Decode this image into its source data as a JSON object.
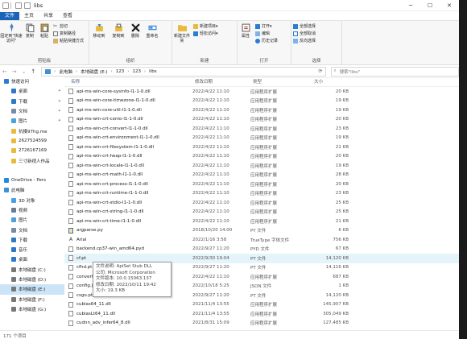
{
  "window": {
    "title": "libs"
  },
  "tabs": [
    "文件",
    "主页",
    "共享",
    "查看"
  ],
  "ribbon": {
    "clipboard": {
      "label": "剪贴板",
      "pin": "固定到\"快速访问\"",
      "copy": "复制",
      "paste": "粘贴",
      "cut": "剪切",
      "copy_path": "复制路径",
      "paste_shortcut": "粘贴快捷方式"
    },
    "organize": {
      "label": "组织",
      "move_to": "移动到",
      "copy_to": "复制到",
      "delete": "删除",
      "rename": "重命名"
    },
    "new": {
      "label": "新建",
      "new_folder": "新建文件夹",
      "new_item": "新建项目",
      "easy_access": "轻松访问"
    },
    "open": {
      "label": "打开",
      "properties": "属性",
      "open": "打开",
      "edit": "编辑",
      "history": "历史记录"
    },
    "select": {
      "label": "选择",
      "select_all": "全部选择",
      "select_none": "全部取消",
      "invert": "反向选择"
    }
  },
  "address": {
    "crumbs": [
      "此电脑",
      "本地磁盘 (E:)",
      "123",
      "123",
      "libs"
    ],
    "search_placeholder": "搜索\"libs\""
  },
  "sidebar": {
    "items": [
      {
        "label": "快速访问",
        "icon": "star-icon",
        "color": "#2b7cd3",
        "indent": 0
      },
      {
        "label": "桌面",
        "icon": "desktop-icon",
        "color": "#2f78c8",
        "indent": 1,
        "pin": true
      },
      {
        "label": "下载",
        "icon": "download-icon",
        "color": "#2f78c8",
        "indent": 1,
        "pin": true
      },
      {
        "label": "文档",
        "icon": "documents-icon",
        "color": "#7a8aa0",
        "indent": 1,
        "pin": true
      },
      {
        "label": "图片",
        "icon": "pictures-icon",
        "color": "#4f9fd8",
        "indent": 1,
        "pin": true
      },
      {
        "label": "抗揍97hg.me",
        "icon": "folder-icon",
        "color": "#e8b93a",
        "indent": 1
      },
      {
        "label": "2627524599",
        "icon": "folder-icon",
        "color": "#e8b93a",
        "indent": 1
      },
      {
        "label": "2726167169",
        "icon": "folder-icon",
        "color": "#e8b93a",
        "indent": 1
      },
      {
        "label": "三寸新视人作品",
        "icon": "folder-icon",
        "color": "#e8b93a",
        "indent": 1
      },
      {
        "label": "",
        "icon": "spacer",
        "color": "",
        "indent": 0
      },
      {
        "label": "OneDrive - Pers",
        "icon": "cloud-icon",
        "color": "#1f8ae0",
        "indent": 0
      },
      {
        "label": "此电脑",
        "icon": "computer-icon",
        "color": "#3d8fd6",
        "indent": 0
      },
      {
        "label": "3D 对象",
        "icon": "cube-icon",
        "color": "#49a0e6",
        "indent": 1
      },
      {
        "label": "视频",
        "icon": "video-icon",
        "color": "#6b7b92",
        "indent": 1
      },
      {
        "label": "图片",
        "icon": "pictures-icon",
        "color": "#4f9fd8",
        "indent": 1
      },
      {
        "label": "文档",
        "icon": "documents-icon",
        "color": "#7a8aa0",
        "indent": 1
      },
      {
        "label": "下载",
        "icon": "download-icon",
        "color": "#2f78c8",
        "indent": 1
      },
      {
        "label": "音乐",
        "icon": "music-icon",
        "color": "#2f78c8",
        "indent": 1
      },
      {
        "label": "桌面",
        "icon": "desktop-icon",
        "color": "#2f78c8",
        "indent": 1
      },
      {
        "label": "本地磁盘 (C:)",
        "icon": "drive-icon",
        "color": "#777777",
        "indent": 1
      },
      {
        "label": "本地磁盘 (D:)",
        "icon": "drive-icon",
        "color": "#777777",
        "indent": 1
      },
      {
        "label": "本地磁盘 (E:)",
        "icon": "drive-icon",
        "color": "#777777",
        "indent": 1,
        "selected": true
      },
      {
        "label": "本地磁盘 (F:)",
        "icon": "drive-icon",
        "color": "#777777",
        "indent": 1
      },
      {
        "label": "本地磁盘 (G:)",
        "icon": "drive-icon",
        "color": "#777777",
        "indent": 1
      }
    ]
  },
  "columns": {
    "name": "名称",
    "date": "修改日期",
    "type": "类型",
    "size": "大小"
  },
  "files": [
    {
      "name": "api-ms-win-core-sysinfo-l1-1-0.dll",
      "date": "2022/4/22 11:10",
      "type": "应用程序扩展",
      "size": "20 KB",
      "kind": "dll"
    },
    {
      "name": "api-ms-win-core-timezone-l1-1-0.dll",
      "date": "2022/4/22 11:10",
      "type": "应用程序扩展",
      "size": "19 KB",
      "kind": "dll"
    },
    {
      "name": "api-ms-win-core-util-l1-1-0.dll",
      "date": "2022/4/22 11:10",
      "type": "应用程序扩展",
      "size": "19 KB",
      "kind": "dll"
    },
    {
      "name": "api-ms-win-crt-conio-l1-1-0.dll",
      "date": "2022/4/22 11:10",
      "type": "应用程序扩展",
      "size": "20 KB",
      "kind": "dll"
    },
    {
      "name": "api-ms-win-crt-convert-l1-1-0.dll",
      "date": "2022/4/22 11:10",
      "type": "应用程序扩展",
      "size": "23 KB",
      "kind": "dll"
    },
    {
      "name": "api-ms-win-crt-environment-l1-1-0.dll",
      "date": "2022/4/22 11:10",
      "type": "应用程序扩展",
      "size": "19 KB",
      "kind": "dll"
    },
    {
      "name": "api-ms-win-crt-filesystem-l1-1-0.dll",
      "date": "2022/4/22 11:10",
      "type": "应用程序扩展",
      "size": "21 KB",
      "kind": "dll"
    },
    {
      "name": "api-ms-win-crt-heap-l1-1-0.dll",
      "date": "2022/4/22 11:10",
      "type": "应用程序扩展",
      "size": "20 KB",
      "kind": "dll"
    },
    {
      "name": "api-ms-win-crt-locale-l1-1-0.dll",
      "date": "2022/4/22 11:10",
      "type": "应用程序扩展",
      "size": "19 KB",
      "kind": "dll"
    },
    {
      "name": "api-ms-win-crt-math-l1-1-0.dll",
      "date": "2022/4/22 11:10",
      "type": "应用程序扩展",
      "size": "28 KB",
      "kind": "dll"
    },
    {
      "name": "api-ms-win-crt-process-l1-1-0.dll",
      "date": "2022/4/22 11:10",
      "type": "应用程序扩展",
      "size": "20 KB",
      "kind": "dll"
    },
    {
      "name": "api-ms-win-crt-runtime-l1-1-0.dll",
      "date": "2022/4/22 11:10",
      "type": "应用程序扩展",
      "size": "23 KB",
      "kind": "dll"
    },
    {
      "name": "api-ms-win-crt-stdio-l1-1-0.dll",
      "date": "2022/4/22 11:10",
      "type": "应用程序扩展",
      "size": "25 KB",
      "kind": "dll"
    },
    {
      "name": "api-ms-win-crt-string-l1-1-0.dll",
      "date": "2022/4/22 11:10",
      "type": "应用程序扩展",
      "size": "25 KB",
      "kind": "dll"
    },
    {
      "name": "api-ms-win-crt-time-l1-1-0.dll",
      "date": "2022/4/22 11:10",
      "type": "应用程序扩展",
      "size": "21 KB",
      "kind": "dll"
    },
    {
      "name": "argparse.py",
      "date": "2018/10/20 14:00",
      "type": "PY 文件",
      "size": "6 KB",
      "kind": "py"
    },
    {
      "name": "Arial",
      "date": "2022/1/16 3:58",
      "type": "TrueType 字体文件",
      "size": "756 KB",
      "kind": "font"
    },
    {
      "name": "backend.cp37-win_amd64.pyd",
      "date": "2022/9/27 11:20",
      "type": "PYD 文件",
      "size": "67 KB",
      "kind": "pyd"
    },
    {
      "name": "cf.pt",
      "date": "2022/9/30 19:04",
      "type": "PT 文件",
      "size": "14,120 KB",
      "kind": "pt",
      "hover": true
    },
    {
      "name": "cfhd.pt",
      "date": "2022/9/27 11:20",
      "type": "PT 文件",
      "size": "14,116 KB",
      "kind": "pt"
    },
    {
      "name": "convert3",
      "date": "2022/4/22 11:10",
      "type": "应用程序扩展",
      "size": "687 KB",
      "kind": "dll"
    },
    {
      "name": "config.js",
      "date": "2022/10/18 5:25",
      "type": "JSON 文件",
      "size": "1 KB",
      "kind": "json"
    },
    {
      "name": "csgo.pt",
      "date": "2022/9/27 11:20",
      "type": "PT 文件",
      "size": "14,120 KB",
      "kind": "pt"
    },
    {
      "name": "cublas64_11.dll",
      "date": "2021/11/4 13:55",
      "type": "应用程序扩展",
      "size": "145,907 KB",
      "kind": "dll"
    },
    {
      "name": "cublasLt64_11.dll",
      "date": "2021/11/4 13:55",
      "type": "应用程序扩展",
      "size": "305,049 KB",
      "kind": "dll"
    },
    {
      "name": "cudnn_adv_infer64_8.dll",
      "date": "2021/8/31 15:09",
      "type": "应用程序扩展",
      "size": "127,485 KB",
      "kind": "dll"
    }
  ],
  "tooltip": {
    "lines": [
      "文件说明: ApiSet Stub DLL",
      "公司: Microsoft Corporation",
      "文件版本: 10.0.15063.137",
      "修改日期: 2022/10/11 19:42",
      "大小: 19.3 KB"
    ]
  },
  "status": {
    "count": "171 个项目"
  }
}
